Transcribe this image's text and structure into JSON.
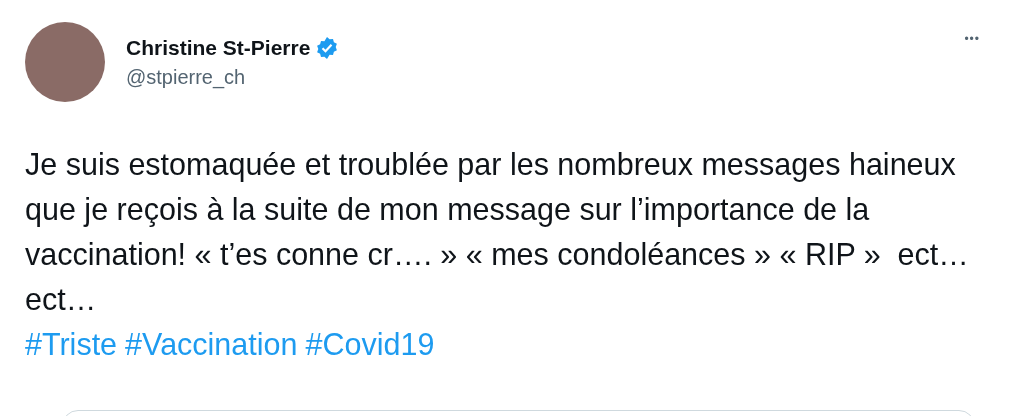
{
  "author": {
    "name": "Christine St-Pierre",
    "verified": true,
    "handle": "@stpierre_ch"
  },
  "more": "•••",
  "text": "Je suis estomaquée et troublée par les nombreux messages haineux que je reçois à la suite de mon message sur l’importance de la vaccination! « t’es conne cr…. » « mes condoléances » « RIP »  ect…ect…",
  "hashtags": [
    "#Triste",
    "#Vaccination",
    "#Covid19"
  ]
}
